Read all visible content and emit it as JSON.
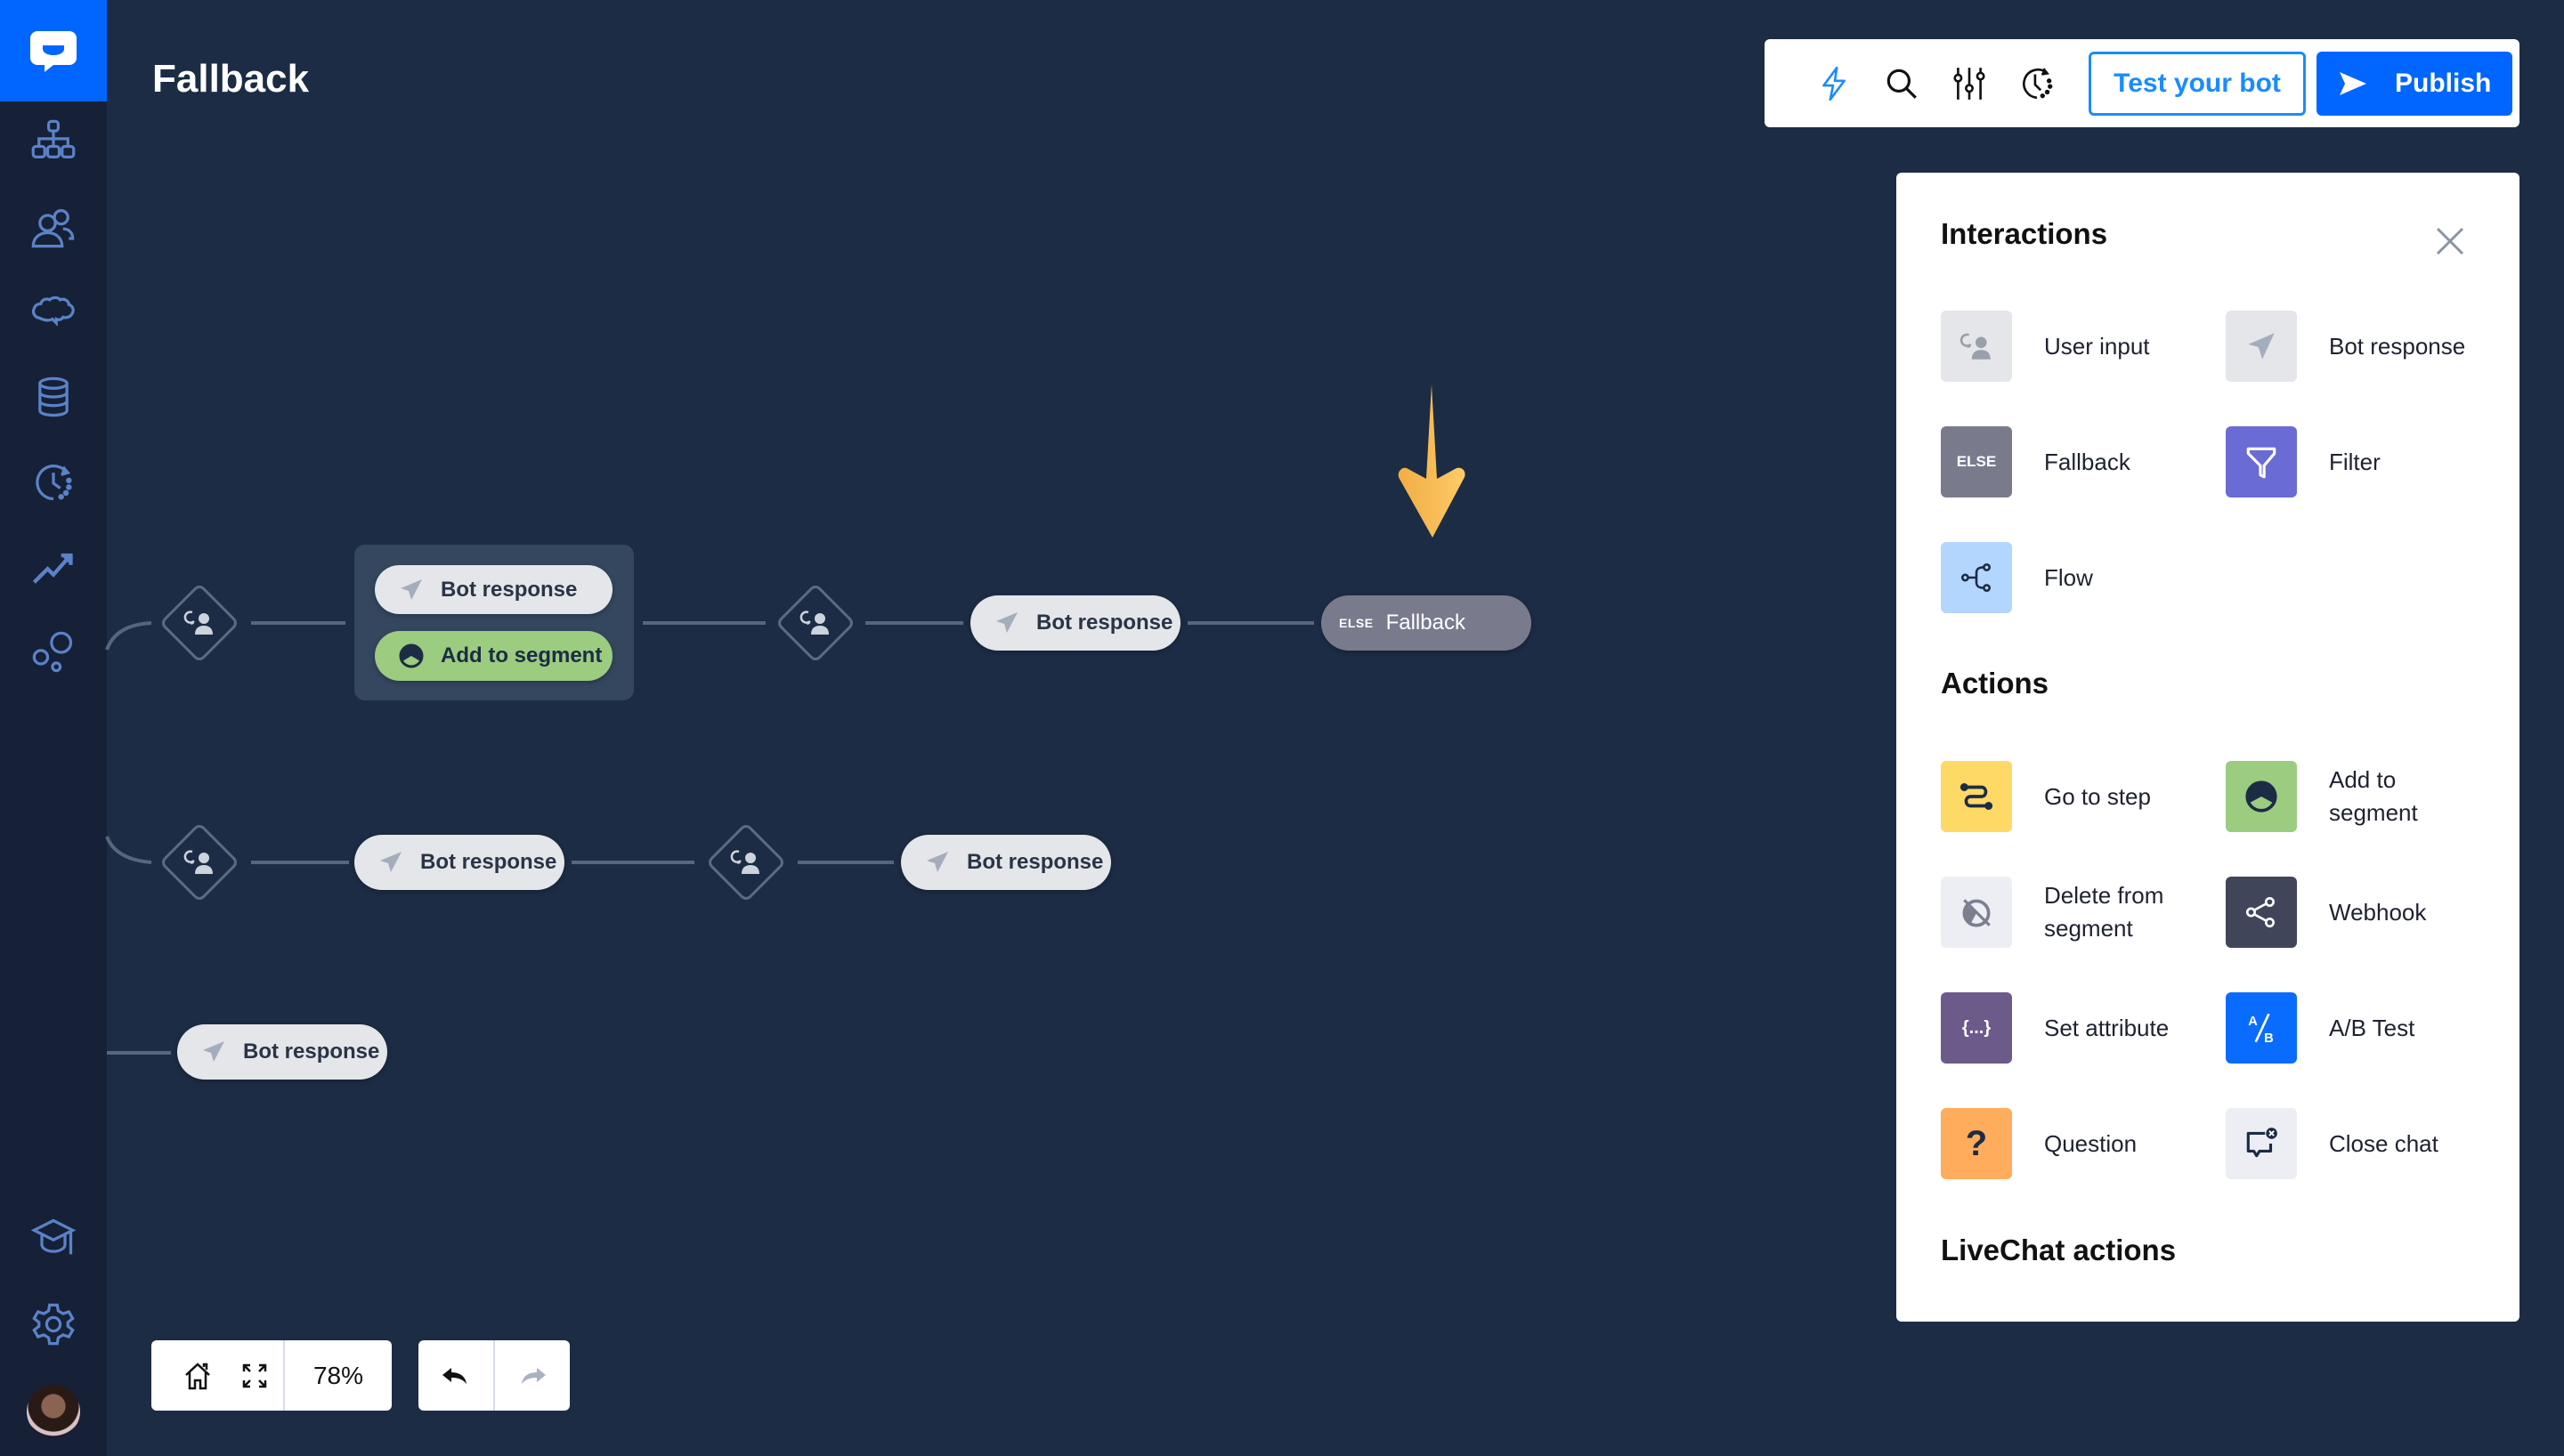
{
  "app": {
    "title": "Fallback"
  },
  "sidebar": {
    "logo": "chat-logo-icon",
    "items": [
      {
        "id": "flows",
        "icon": "sitemap-icon"
      },
      {
        "id": "audience",
        "icon": "users-icon"
      },
      {
        "id": "training",
        "icon": "brain-icon"
      },
      {
        "id": "data",
        "icon": "database-icon"
      },
      {
        "id": "history",
        "icon": "history-icon"
      },
      {
        "id": "reports",
        "icon": "trend-icon"
      },
      {
        "id": "integrations",
        "icon": "bubbles-icon"
      }
    ],
    "bottom_items": [
      {
        "id": "academy",
        "icon": "graduation-cap-icon"
      },
      {
        "id": "settings",
        "icon": "gear-icon"
      }
    ]
  },
  "toolbar": {
    "icons": [
      "lightning-icon",
      "search-icon",
      "sliders-icon",
      "history-icon"
    ],
    "test_label": "Test your bot",
    "publish_label": "Publish",
    "accent": "#0066ff"
  },
  "canvas": {
    "row1": {
      "group": [
        {
          "label": "Bot response",
          "type": "bot-response"
        },
        {
          "label": "Add to segment",
          "type": "add-to-segment"
        }
      ],
      "bot_response": "Bot response",
      "fallback": {
        "tag": "ELSE",
        "label": "Fallback"
      }
    },
    "row2": {
      "nodes": [
        "Bot response",
        "Bot response"
      ]
    },
    "row3": {
      "nodes": [
        "Bot response"
      ]
    }
  },
  "zoom_controls": {
    "level": "78%"
  },
  "panel": {
    "sections": [
      {
        "title": "Interactions",
        "items": [
          {
            "label": "User input",
            "icon": "user-input-icon",
            "color": "#e4e6ea"
          },
          {
            "label": "Bot response",
            "icon": "paper-plane-icon",
            "color": "#e4e6ea"
          },
          {
            "label": "Fallback",
            "icon": "else-icon",
            "icon_text": "ELSE",
            "color": "#797b8d"
          },
          {
            "label": "Filter",
            "icon": "funnel-icon",
            "color": "#6a6bd4"
          },
          {
            "label": "Flow",
            "icon": "flow-icon",
            "color": "#b3d6ff"
          }
        ]
      },
      {
        "title": "Actions",
        "items": [
          {
            "label": "Go to step",
            "icon": "route-icon",
            "color": "#ffd966"
          },
          {
            "label": "Add to segment",
            "icon": "pie-chart-icon",
            "color": "#9ccc80"
          },
          {
            "label": "Delete from segment",
            "icon": "pie-chart-off-icon",
            "color": "#eceef4"
          },
          {
            "label": "Webhook",
            "icon": "share-icon",
            "color": "#40455a"
          },
          {
            "label": "Set attribute",
            "icon": "braces-icon",
            "icon_text": "{...}",
            "color": "#6b5a8a"
          },
          {
            "label": "A/B Test",
            "icon": "ab-test-icon",
            "color": "#0a6cff"
          },
          {
            "label": "Question",
            "icon": "question-icon",
            "icon_text": "?",
            "color": "#ffad5c"
          },
          {
            "label": "Close chat",
            "icon": "close-chat-icon",
            "color": "#eceef4"
          }
        ]
      },
      {
        "title": "LiveChat actions",
        "items": []
      }
    ]
  }
}
